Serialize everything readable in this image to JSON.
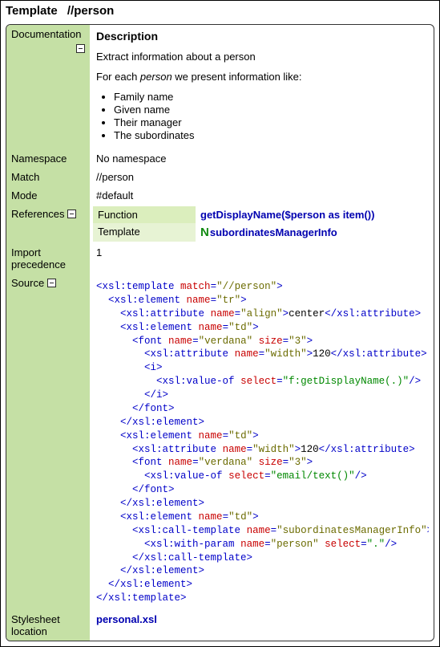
{
  "header": {
    "type": "Template",
    "name": "//person"
  },
  "rows": {
    "documentation": {
      "label": "Documentation",
      "desc_heading": "Description",
      "desc_line1": "Extract information about a person",
      "desc_line2_pre": "For each ",
      "desc_line2_em": "person",
      "desc_line2_post": " we present information like:",
      "items": [
        "Family name",
        "Given name",
        "Their manager",
        "The subordinates"
      ]
    },
    "namespace": {
      "label": "Namespace",
      "value": "No namespace"
    },
    "match": {
      "label": "Match",
      "value": "//person"
    },
    "mode": {
      "label": "Mode",
      "value": "#default"
    },
    "references": {
      "label": "References",
      "function_label": "Function",
      "function_value": "getDisplayName($person as item())",
      "template_label": "Template",
      "template_prefix": "N",
      "template_value": "subordinatesManagerInfo"
    },
    "import": {
      "label": "Import precedence",
      "value": "1"
    },
    "source": {
      "label": "Source"
    },
    "stylesheet": {
      "label": "Stylesheet location",
      "value": "personal.xsl"
    }
  },
  "source_tokens": [
    [
      [
        "blue",
        "<xsl:template"
      ],
      [
        "txt",
        " "
      ],
      [
        "red",
        "match"
      ],
      [
        "blue",
        "="
      ],
      [
        "olv",
        "\"//person\""
      ],
      [
        "blue",
        ">"
      ]
    ],
    [
      [
        "txt",
        "  "
      ],
      [
        "blue",
        "<xsl:element"
      ],
      [
        "txt",
        " "
      ],
      [
        "red",
        "name"
      ],
      [
        "blue",
        "="
      ],
      [
        "olv",
        "\"tr\""
      ],
      [
        "blue",
        ">"
      ]
    ],
    [
      [
        "txt",
        "    "
      ],
      [
        "blue",
        "<xsl:attribute"
      ],
      [
        "txt",
        " "
      ],
      [
        "red",
        "name"
      ],
      [
        "blue",
        "="
      ],
      [
        "olv",
        "\"align\""
      ],
      [
        "blue",
        ">"
      ],
      [
        "blk",
        "center"
      ],
      [
        "blue",
        "</xsl:attribute>"
      ]
    ],
    [
      [
        "txt",
        "    "
      ],
      [
        "blue",
        "<xsl:element"
      ],
      [
        "txt",
        " "
      ],
      [
        "red",
        "name"
      ],
      [
        "blue",
        "="
      ],
      [
        "olv",
        "\"td\""
      ],
      [
        "blue",
        ">"
      ]
    ],
    [
      [
        "txt",
        "      "
      ],
      [
        "blue",
        "<font"
      ],
      [
        "txt",
        " "
      ],
      [
        "red",
        "name"
      ],
      [
        "blue",
        "="
      ],
      [
        "olv",
        "\"verdana\""
      ],
      [
        "txt",
        " "
      ],
      [
        "red",
        "size"
      ],
      [
        "blue",
        "="
      ],
      [
        "olv",
        "\"3\""
      ],
      [
        "blue",
        ">"
      ]
    ],
    [
      [
        "txt",
        "        "
      ],
      [
        "blue",
        "<xsl:attribute"
      ],
      [
        "txt",
        " "
      ],
      [
        "red",
        "name"
      ],
      [
        "blue",
        "="
      ],
      [
        "olv",
        "\"width\""
      ],
      [
        "blue",
        ">"
      ],
      [
        "blk",
        "120"
      ],
      [
        "blue",
        "</xsl:attribute>"
      ]
    ],
    [
      [
        "txt",
        "        "
      ],
      [
        "blue",
        "<i>"
      ]
    ],
    [
      [
        "txt",
        "          "
      ],
      [
        "blue",
        "<xsl:value-of"
      ],
      [
        "txt",
        " "
      ],
      [
        "red",
        "select"
      ],
      [
        "blue",
        "="
      ],
      [
        "grn",
        "\"f:getDisplayName(.)\""
      ],
      [
        "blue",
        "/>"
      ]
    ],
    [
      [
        "txt",
        "        "
      ],
      [
        "blue",
        "</i>"
      ]
    ],
    [
      [
        "txt",
        "      "
      ],
      [
        "blue",
        "</font>"
      ]
    ],
    [
      [
        "txt",
        "    "
      ],
      [
        "blue",
        "</xsl:element>"
      ]
    ],
    [
      [
        "txt",
        "    "
      ],
      [
        "blue",
        "<xsl:element"
      ],
      [
        "txt",
        " "
      ],
      [
        "red",
        "name"
      ],
      [
        "blue",
        "="
      ],
      [
        "olv",
        "\"td\""
      ],
      [
        "blue",
        ">"
      ]
    ],
    [
      [
        "txt",
        "      "
      ],
      [
        "blue",
        "<xsl:attribute"
      ],
      [
        "txt",
        " "
      ],
      [
        "red",
        "name"
      ],
      [
        "blue",
        "="
      ],
      [
        "olv",
        "\"width\""
      ],
      [
        "blue",
        ">"
      ],
      [
        "blk",
        "120"
      ],
      [
        "blue",
        "</xsl:attribute>"
      ]
    ],
    [
      [
        "txt",
        "      "
      ],
      [
        "blue",
        "<font"
      ],
      [
        "txt",
        " "
      ],
      [
        "red",
        "name"
      ],
      [
        "blue",
        "="
      ],
      [
        "olv",
        "\"verdana\""
      ],
      [
        "txt",
        " "
      ],
      [
        "red",
        "size"
      ],
      [
        "blue",
        "="
      ],
      [
        "olv",
        "\"3\""
      ],
      [
        "blue",
        ">"
      ]
    ],
    [
      [
        "txt",
        "        "
      ],
      [
        "blue",
        "<xsl:value-of"
      ],
      [
        "txt",
        " "
      ],
      [
        "red",
        "select"
      ],
      [
        "blue",
        "="
      ],
      [
        "grn",
        "\"email/text()\""
      ],
      [
        "blue",
        "/>"
      ]
    ],
    [
      [
        "txt",
        "      "
      ],
      [
        "blue",
        "</font>"
      ]
    ],
    [
      [
        "txt",
        "    "
      ],
      [
        "blue",
        "</xsl:element>"
      ]
    ],
    [
      [
        "txt",
        "    "
      ],
      [
        "blue",
        "<xsl:element"
      ],
      [
        "txt",
        " "
      ],
      [
        "red",
        "name"
      ],
      [
        "blue",
        "="
      ],
      [
        "olv",
        "\"td\""
      ],
      [
        "blue",
        ">"
      ]
    ],
    [
      [
        "txt",
        "      "
      ],
      [
        "blue",
        "<xsl:call-template"
      ],
      [
        "txt",
        " "
      ],
      [
        "red",
        "name"
      ],
      [
        "blue",
        "="
      ],
      [
        "olv",
        "\"subordinatesManagerInfo\""
      ],
      [
        "blue",
        ">"
      ]
    ],
    [
      [
        "txt",
        "        "
      ],
      [
        "blue",
        "<xsl:with-param"
      ],
      [
        "txt",
        " "
      ],
      [
        "red",
        "name"
      ],
      [
        "blue",
        "="
      ],
      [
        "olv",
        "\"person\""
      ],
      [
        "txt",
        " "
      ],
      [
        "red",
        "select"
      ],
      [
        "blue",
        "="
      ],
      [
        "grn",
        "\".\""
      ],
      [
        "blue",
        "/>"
      ]
    ],
    [
      [
        "txt",
        "      "
      ],
      [
        "blue",
        "</xsl:call-template>"
      ]
    ],
    [
      [
        "txt",
        "    "
      ],
      [
        "blue",
        "</xsl:element>"
      ]
    ],
    [
      [
        "txt",
        "  "
      ],
      [
        "blue",
        "</xsl:element>"
      ]
    ],
    [
      [
        "blue",
        "</xsl:template>"
      ]
    ]
  ]
}
